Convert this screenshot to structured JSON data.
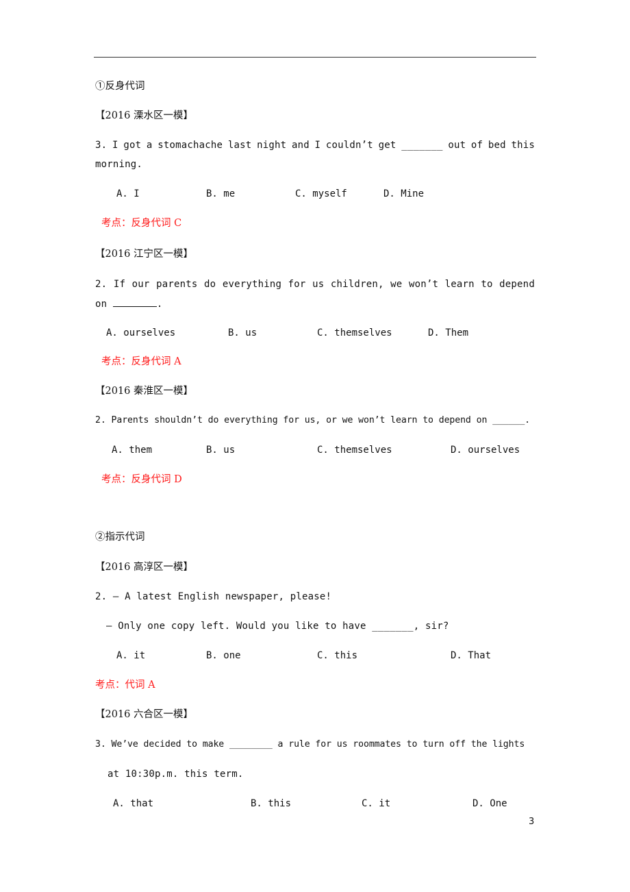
{
  "sections": [
    {
      "heading": "①反身代词",
      "questions": [
        {
          "source": "【2016 溧水区一模】",
          "stem_line1_words": [
            "3.",
            "I",
            "got",
            "a",
            "stomachache",
            "last",
            "night",
            "and",
            "I",
            "couldn’t",
            "get",
            "_______",
            "out",
            "of",
            "bed",
            "this"
          ],
          "stem_line2": "morning.",
          "options": [
            "A. I",
            "B. me",
            "C. myself",
            "D. Mine"
          ],
          "answer": "考点：反身代词 C"
        },
        {
          "source": "【2016 江宁区一模】",
          "stem_line1_words": [
            "2.",
            "If",
            "our",
            "parents",
            "do",
            "everything",
            "for",
            "us",
            "children,",
            "we",
            "won’t",
            "learn",
            "to",
            "depend"
          ],
          "stem_line2_pre": "on ",
          "stem_line2_post": ".",
          "options": [
            "A. ourselves",
            "B. us",
            "C. themselves",
            "D. Them"
          ],
          "answer": "考点：反身代词 A"
        },
        {
          "source": "【2016 秦淮区一模】",
          "stem_line1": "2. Parents shouldn’t do everything for us, or we won’t learn to depend on ______.",
          "options": [
            "A. them",
            "B. us",
            "C. themselves",
            "D. ourselves"
          ],
          "answer": "考点：反身代词 D"
        }
      ]
    },
    {
      "heading": "②指示代词",
      "questions": [
        {
          "source": "【2016 高淳区一模】",
          "stem_line1": "2. — A latest English newspaper, please!",
          "stem_line2": "— Only one copy left. Would you like to have _______, sir?",
          "options": [
            "A. it",
            "B. one",
            "C. this",
            "D. That"
          ],
          "answer": "考点：代词  A"
        },
        {
          "source": "【2016 六合区一模】",
          "stem_line1": "3. We’ve decided to make ________ a rule for us roommates to turn off the lights",
          "stem_line2": "at 10:30p.m. this term.",
          "options": [
            "A. that",
            "B. this",
            "C. it",
            "D. One"
          ]
        }
      ]
    }
  ],
  "page_number": "3",
  "colors": {
    "answer_red": "#ff1a1a",
    "text": "#111111"
  }
}
